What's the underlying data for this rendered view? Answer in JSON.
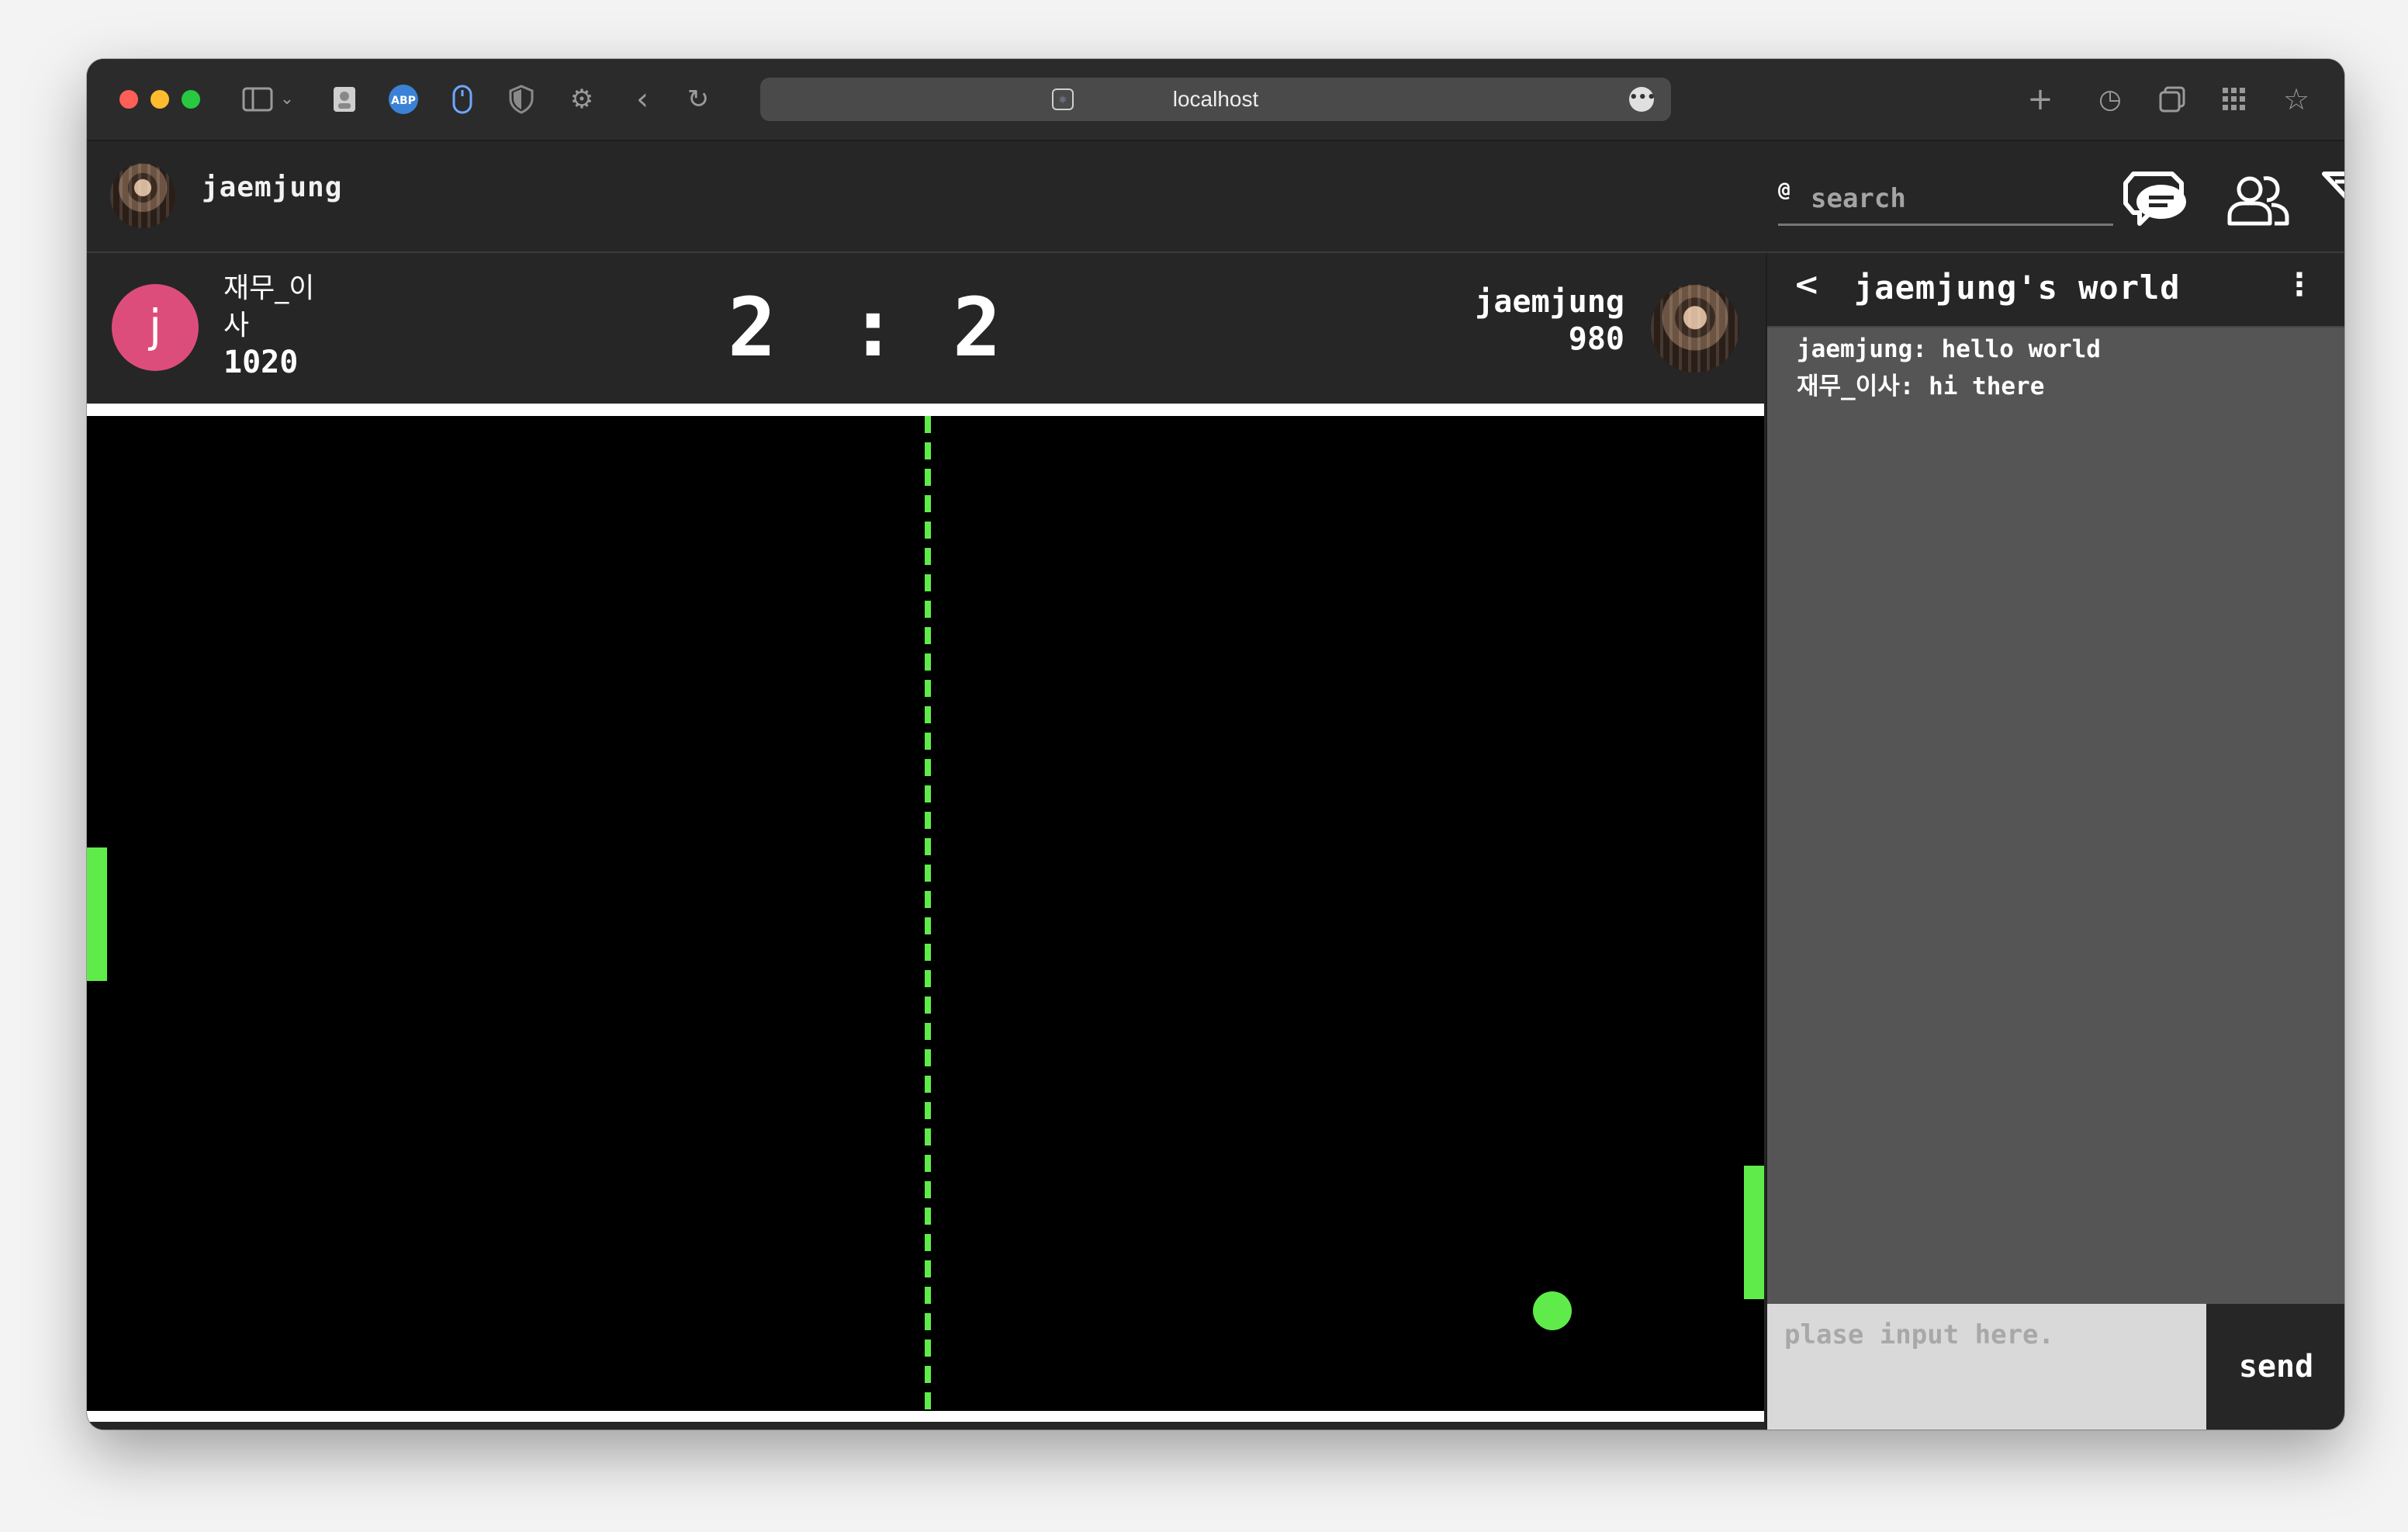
{
  "browser": {
    "url": "localhost",
    "colors": {
      "close": "#ff5f57",
      "minimize": "#febc2e",
      "zoom": "#28c840"
    }
  },
  "header": {
    "username": "jaemjung",
    "search": {
      "prefix": "@",
      "placeholder": "search"
    }
  },
  "game": {
    "player_left": {
      "avatar_letter": "j",
      "name": "재무_이사",
      "rating": "1020"
    },
    "player_right": {
      "name": "jaemjung",
      "rating": "980"
    },
    "score_left": "2",
    "separator": ":",
    "score_right": "2",
    "accent_color": "#5fec4a"
  },
  "chat": {
    "title": "jaemjung's world",
    "back_icon": "chevron-left-icon",
    "menu_icon": "more-vertical-icon",
    "messages": [
      "jaemjung: hello world",
      "재무_이사: hi there"
    ],
    "input_placeholder": "plase input here.",
    "send_label": "send"
  }
}
